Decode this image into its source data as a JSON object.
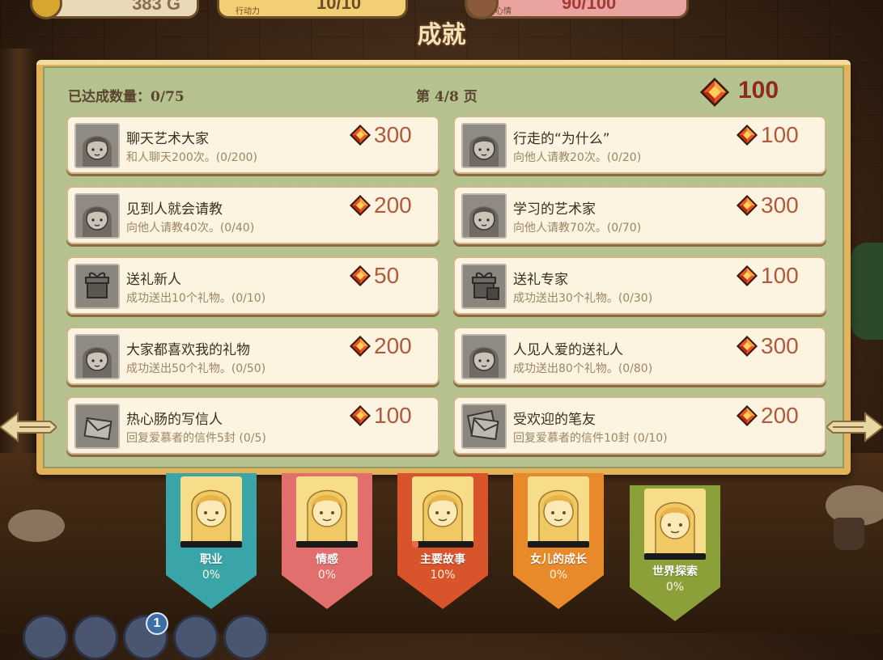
{
  "hud": {
    "gold": "383 G",
    "energy_label": "行动力",
    "energy": "10/10",
    "mood_label": "心情",
    "mood": "90/100"
  },
  "title": "成就",
  "header": {
    "count": "已达成数量：0/75",
    "page": "第 4/8 页",
    "total_points": "100"
  },
  "achievements": [
    {
      "name": "聊天艺术大家",
      "desc": "和人聊天200次。(0/200)",
      "reward": "300",
      "icon": "portrait-sketch-icon"
    },
    {
      "name": "行走的“为什么”",
      "desc": "向他人请教20次。(0/20)",
      "reward": "100",
      "icon": "portrait-sketch-icon"
    },
    {
      "name": "见到人就会请教",
      "desc": "向他人请教40次。(0/40)",
      "reward": "200",
      "icon": "portrait-sketch-icon"
    },
    {
      "name": "学习的艺术家",
      "desc": "向他人请教70次。(0/70)",
      "reward": "300",
      "icon": "portrait-sketch-icon"
    },
    {
      "name": "送礼新人",
      "desc": "成功送出10个礼物。(0/10)",
      "reward": "50",
      "icon": "gift-icon"
    },
    {
      "name": "送礼专家",
      "desc": "成功送出30个礼物。(0/30)",
      "reward": "100",
      "icon": "gifts-icon"
    },
    {
      "name": "大家都喜欢我的礼物",
      "desc": "成功送出50个礼物。(0/50)",
      "reward": "200",
      "icon": "portrait-sketch-icon"
    },
    {
      "name": "人见人爱的送礼人",
      "desc": "成功送出80个礼物。(0/80)",
      "reward": "300",
      "icon": "portrait-sketch-icon"
    },
    {
      "name": "热心肠的写信人",
      "desc": "回复爱慕者的信件5封 (0/5)",
      "reward": "100",
      "icon": "letter-icon"
    },
    {
      "name": "受欢迎的笔友",
      "desc": "回复爱慕者的信件10封 (0/10)",
      "reward": "200",
      "icon": "letters-icon"
    }
  ],
  "categories": [
    {
      "label": "职业",
      "pct": "0%",
      "progress": 0,
      "color": "#3aa5a8"
    },
    {
      "label": "情感",
      "pct": "0%",
      "progress": 0,
      "color": "#e26e6e"
    },
    {
      "label": "主要故事",
      "pct": "10%",
      "progress": 0.1,
      "color": "#d9542b"
    },
    {
      "label": "女儿的成长",
      "pct": "0%",
      "progress": 0,
      "color": "#e88a2a"
    },
    {
      "label": "世界探索",
      "pct": "0%",
      "progress": 0,
      "color": "#8ca03a"
    }
  ],
  "bottom_badge": "1",
  "colors": {
    "panel_frame": "#e2b358",
    "panel_bg": "#b5c28e",
    "card_bg": "#fcf3e1",
    "reward_text": "#b05a3c",
    "gem": "#c8361c"
  }
}
